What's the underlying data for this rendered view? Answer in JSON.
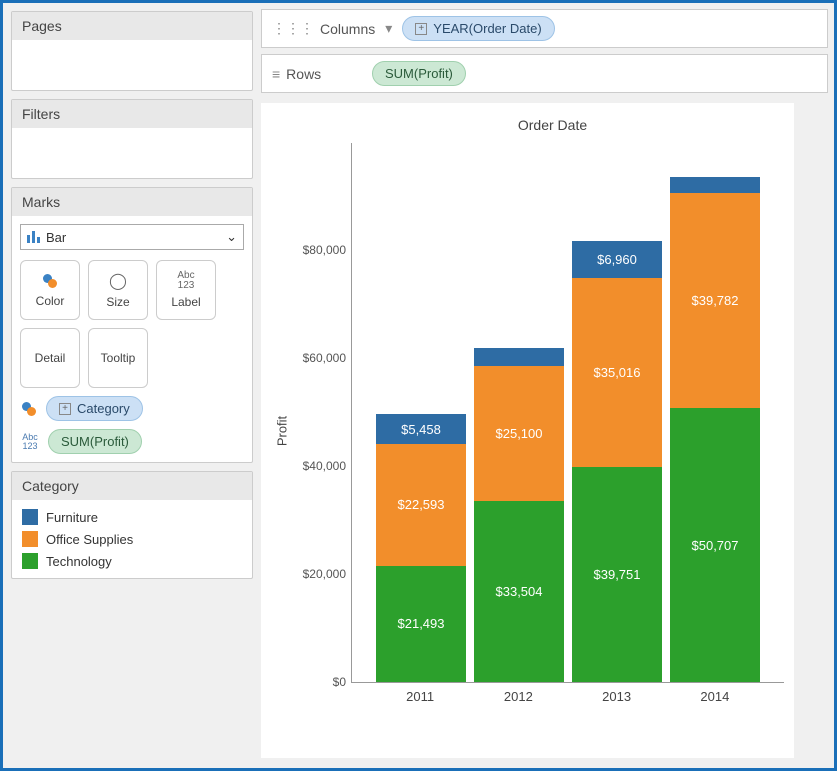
{
  "pages": {
    "title": "Pages"
  },
  "filters": {
    "title": "Filters"
  },
  "marks": {
    "title": "Marks",
    "type_label": "Bar",
    "buttons": {
      "color": "Color",
      "size": "Size",
      "label": "Label",
      "detail": "Detail",
      "tooltip": "Tooltip"
    },
    "abc123": "Abc\n123",
    "shelf_color": "Category",
    "shelf_label": "SUM(Profit)"
  },
  "legend": {
    "title": "Category",
    "items": [
      {
        "label": "Furniture",
        "color": "#2e6ca4"
      },
      {
        "label": "Office Supplies",
        "color": "#f28e2b"
      },
      {
        "label": "Technology",
        "color": "#2ca02c"
      }
    ]
  },
  "columns": {
    "label": "Columns",
    "pill": "YEAR(Order Date)"
  },
  "rows": {
    "label": "Rows",
    "pill": "SUM(Profit)"
  },
  "chart_data": {
    "type": "bar",
    "stacked": true,
    "title": "Order Date",
    "ylabel": "Profit",
    "xlabel": "",
    "ylim": [
      0,
      100000
    ],
    "y_ticks": [
      {
        "value": 0,
        "label": "$0"
      },
      {
        "value": 20000,
        "label": "$20,000"
      },
      {
        "value": 40000,
        "label": "$40,000"
      },
      {
        "value": 60000,
        "label": "$60,000"
      },
      {
        "value": 80000,
        "label": "$80,000"
      }
    ],
    "categories": [
      "2011",
      "2012",
      "2013",
      "2014"
    ],
    "series": [
      {
        "name": "Technology",
        "color": "#2ca02c",
        "values": [
          21493,
          33504,
          39751,
          50707
        ],
        "labels": [
          "$21,493",
          "$33,504",
          "$39,751",
          "$50,707"
        ]
      },
      {
        "name": "Office Supplies",
        "color": "#f28e2b",
        "values": [
          22593,
          25100,
          35016,
          39782
        ],
        "labels": [
          "$22,593",
          "$25,100",
          "$35,016",
          "$39,782"
        ]
      },
      {
        "name": "Furniture",
        "color": "#2e6ca4",
        "values": [
          5458,
          3300,
          6960,
          3100
        ],
        "labels": [
          "$5,458",
          "",
          "$6,960",
          ""
        ]
      }
    ]
  }
}
